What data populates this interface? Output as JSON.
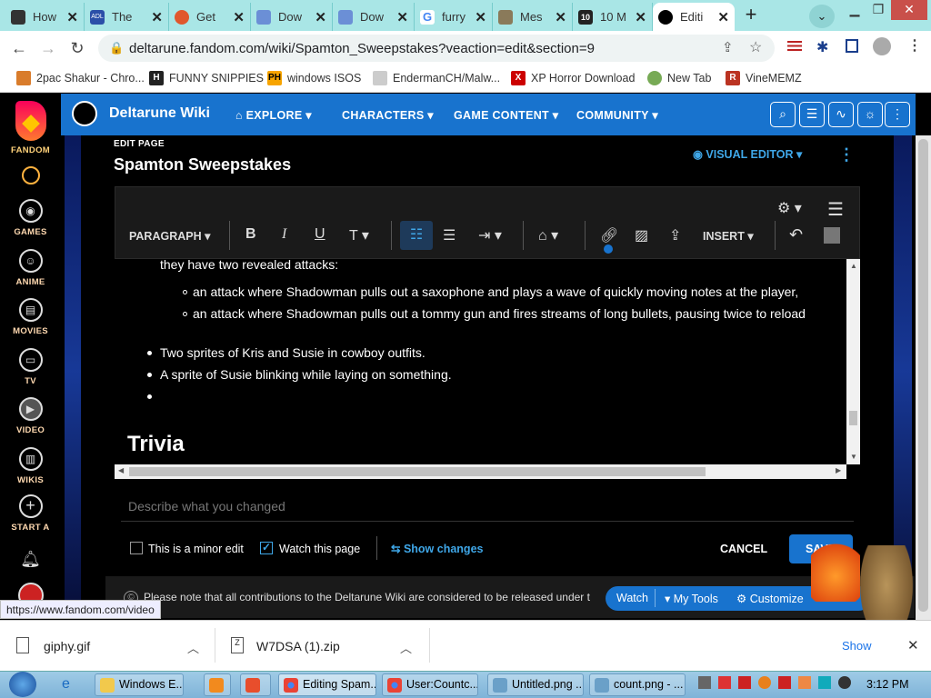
{
  "browser": {
    "tabs": [
      {
        "title": "How",
        "icon": "tab-favicon"
      },
      {
        "title": "The",
        "icon": "tab-favicon"
      },
      {
        "title": "Get",
        "icon": "tab-favicon"
      },
      {
        "title": "Dow",
        "icon": "tab-favicon"
      },
      {
        "title": "Dow",
        "icon": "tab-favicon"
      },
      {
        "title": "furry",
        "icon": "google-icon"
      },
      {
        "title": "Mes",
        "icon": "tab-favicon"
      },
      {
        "title": "10 M",
        "icon": "tab-favicon"
      },
      {
        "title": "Editi",
        "icon": "deltarune-icon"
      }
    ],
    "url": "deltarune.fandom.com/wiki/Spamton_Sweepstakes?veaction=edit&section=9",
    "bookmarks": [
      "2pac Shakur - Chro...",
      "FUNNY SNIPPIES",
      "windows ISOS",
      "EndermanCH/Malw...",
      "XP Horror Download",
      "New Tab",
      "VineMEMZ"
    ]
  },
  "fandom_sidebar": {
    "brand": "FANDOM",
    "items": [
      "GAMES",
      "ANIME",
      "MOVIES",
      "TV",
      "VIDEO",
      "WIKIS",
      "START A"
    ]
  },
  "wiki_header": {
    "name": "Deltarune Wiki",
    "nav": [
      "EXPLORE",
      "CHARACTERS",
      "GAME CONTENT",
      "COMMUNITY"
    ]
  },
  "editor": {
    "label": "EDIT PAGE",
    "title": "Spamton Sweepstakes",
    "mode": "VISUAL EDITOR",
    "toolbar": {
      "paragraph": "PARAGRAPH",
      "insert": "INSERT"
    },
    "content": {
      "intro": "they have two revealed attacks:",
      "sub_items": [
        "an attack where Shadowman pulls out a saxophone and plays a wave of quickly moving notes at the player,",
        "an attack where Shadowman pulls out a tommy gun and fires streams of long bullets, pausing twice to reload"
      ],
      "items": [
        "Two sprites of Kris and Susie in cowboy outfits.",
        "A sprite of Susie blinking while laying on something.",
        ""
      ],
      "heading": "Trivia"
    },
    "summary_placeholder": "Describe what you changed",
    "minor_edit": {
      "label": "This is a minor edit",
      "checked": false
    },
    "watch": {
      "label": "Watch this page",
      "checked": true
    },
    "show_changes": "Show changes",
    "cancel": "CANCEL",
    "save": "SAVE",
    "license": "Please note that all contributions to the Deltarune Wiki are considered to be released under t"
  },
  "toolpill": {
    "watch": "Watch",
    "mytools": "My Tools",
    "customize": "Customize"
  },
  "status_url": "https://www.fandom.com/video",
  "downloads": [
    {
      "name": "giphy.gif"
    },
    {
      "name": "W7DSA (1).zip"
    }
  ],
  "downloads_show_all": "Show",
  "taskbar": {
    "tasks": [
      "Windows E...",
      "",
      "",
      "Editing Spam...",
      "User:Countc...",
      "Untitled.png ...",
      "count.png - ..."
    ],
    "time": "3:12 PM"
  },
  "colors": {
    "fandom_blue": "#1873ce",
    "accent": "#3fa7e8",
    "tabbar": "#a9e6e6"
  }
}
